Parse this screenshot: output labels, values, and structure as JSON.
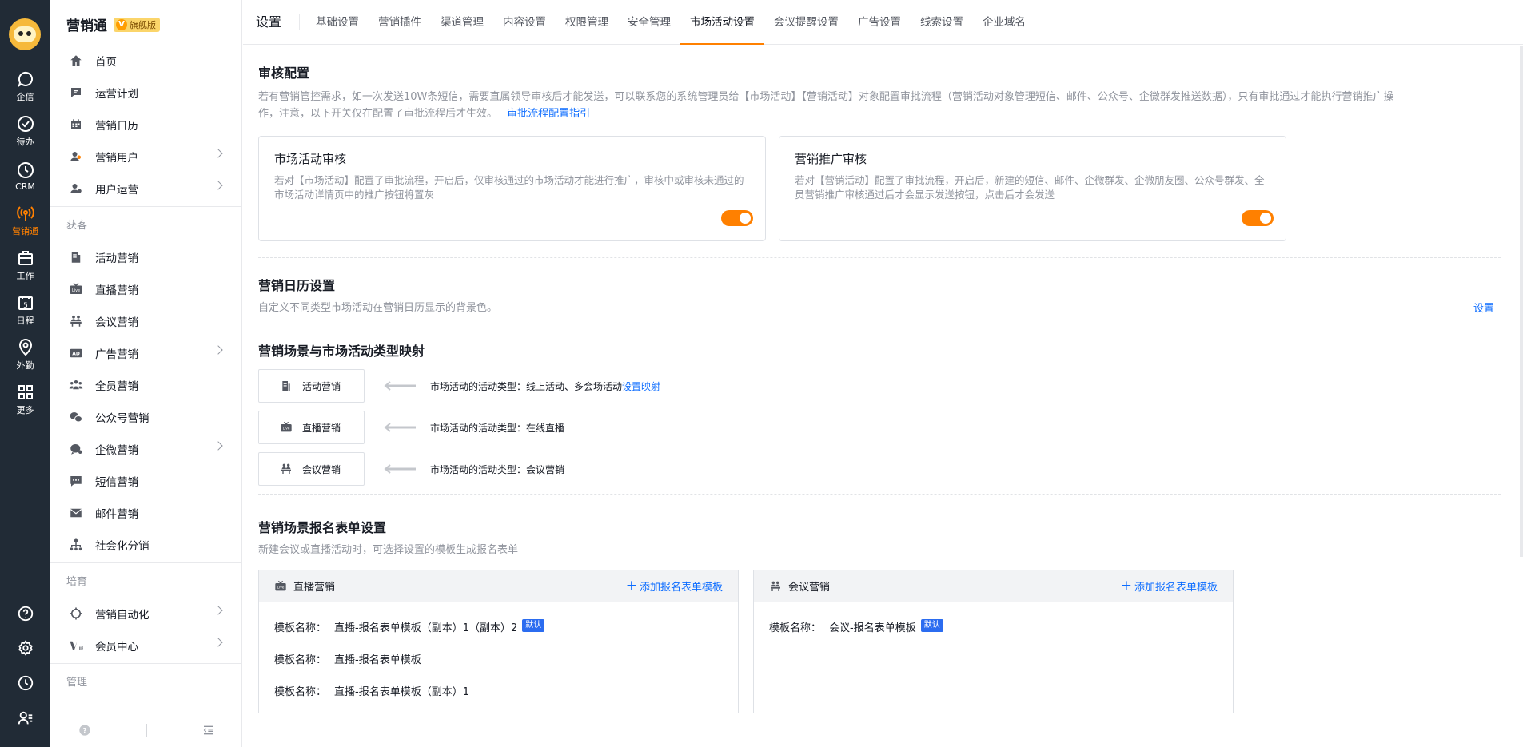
{
  "rail": {
    "items": [
      {
        "label": "企信",
        "icon": "chat-icon"
      },
      {
        "label": "待办",
        "icon": "check-icon"
      },
      {
        "label": "CRM",
        "icon": "clock-icon"
      },
      {
        "label": "营销通",
        "icon": "broadcast-icon"
      },
      {
        "label": "工作",
        "icon": "briefcase-icon"
      },
      {
        "label": "日程",
        "icon": "calendar-icon"
      },
      {
        "label": "外勤",
        "icon": "location-icon"
      },
      {
        "label": "更多",
        "icon": "grid-icon"
      }
    ],
    "calendar_day": "5"
  },
  "sidebar": {
    "brand": "营销通",
    "badge_icon": "V",
    "badge": "旗舰版",
    "items_top": [
      {
        "label": "首页",
        "icon": "home-icon"
      },
      {
        "label": "运营计划",
        "icon": "plan-icon"
      },
      {
        "label": "营销日历",
        "icon": "calendar-icon"
      },
      {
        "label": "营销用户",
        "icon": "users-icon"
      },
      {
        "label": "用户运营",
        "icon": "user-ops-icon"
      }
    ],
    "group_acquire": "获客",
    "items_acquire": [
      {
        "label": "活动营销",
        "icon": "document-icon"
      },
      {
        "label": "直播营销",
        "icon": "live-icon"
      },
      {
        "label": "会议营销",
        "icon": "meeting-icon"
      },
      {
        "label": "广告营销",
        "icon": "ad-icon"
      },
      {
        "label": "全员营销",
        "icon": "team-icon"
      },
      {
        "label": "公众号营销",
        "icon": "wechat-icon"
      },
      {
        "label": "企微营销",
        "icon": "wecom-icon"
      },
      {
        "label": "短信营销",
        "icon": "sms-icon"
      },
      {
        "label": "邮件营销",
        "icon": "mail-icon"
      },
      {
        "label": "社会化分销",
        "icon": "distribution-icon"
      }
    ],
    "group_nurture": "培育",
    "items_nurture": [
      {
        "label": "营销自动化",
        "icon": "automation-icon"
      },
      {
        "label": "会员中心",
        "icon": "vip-icon"
      }
    ],
    "group_manage": "管理"
  },
  "topbar": {
    "title": "设置",
    "tabs": [
      "基础设置",
      "营销插件",
      "渠道管理",
      "内容设置",
      "权限管理",
      "安全管理",
      "市场活动设置",
      "会议提醒设置",
      "广告设置",
      "线索设置",
      "企业域名"
    ],
    "active_tab": "市场活动设置"
  },
  "audit": {
    "title": "审核配置",
    "desc": "若有营销管控需求，如一次发送10W条短信，需要直属领导审核后才能发送，可以联系您的系统管理员给【市场活动】【营销活动】对象配置审批流程（营销活动对象管理短信、邮件、公众号、企微群发推送数据），只有审批通过才能执行营销推广操作，注意，以下开关仅在配置了审批流程后才生效。",
    "link": "审批流程配置指引",
    "cards": [
      {
        "title": "市场活动审核",
        "desc": "若对【市场活动】配置了审批流程，开启后，仅审核通过的市场活动才能进行推广，审核中或审核未通过的市场活动详情页中的推广按钮将置灰",
        "enabled": true
      },
      {
        "title": "营销推广审核",
        "desc": "若对【营销活动】配置了审批流程，开启后，新建的短信、邮件、企微群发、企微朋友圈、公众号群发、全员营销推广审核通过后才会显示发送按钮，点击后才会发送",
        "enabled": true
      }
    ]
  },
  "calendar_setting": {
    "title": "营销日历设置",
    "desc": "自定义不同类型市场活动在营销日历显示的背景色。",
    "action": "设置"
  },
  "mapping": {
    "title": "营销场景与市场活动类型映射",
    "rows": [
      {
        "scene": "活动营销",
        "icon": "document-icon",
        "text": "市场活动的活动类型：线上活动、多会场活动",
        "link": "设置映射"
      },
      {
        "scene": "直播营销",
        "icon": "live-icon",
        "text": "市场活动的活动类型：在线直播",
        "link": ""
      },
      {
        "scene": "会议营销",
        "icon": "meeting-icon",
        "text": "市场活动的活动类型：会议营销",
        "link": ""
      }
    ]
  },
  "forms": {
    "title": "营销场景报名表单设置",
    "desc": "新建会议或直播活动时，可选择设置的模板生成报名表单",
    "add_label": "添加报名表单模板",
    "template_label": "模板名称：",
    "default_tag": "默认",
    "cards": [
      {
        "scene": "直播营销",
        "icon": "live-icon",
        "templates": [
          {
            "name": "直播-报名表单模板（副本）1（副本）2",
            "default": true
          },
          {
            "name": "直播-报名表单模板",
            "default": false
          },
          {
            "name": "直播-报名表单模板（副本）1",
            "default": false
          }
        ]
      },
      {
        "scene": "会议营销",
        "icon": "meeting-icon",
        "templates": [
          {
            "name": "会议-报名表单模板",
            "default": true
          }
        ]
      }
    ]
  }
}
